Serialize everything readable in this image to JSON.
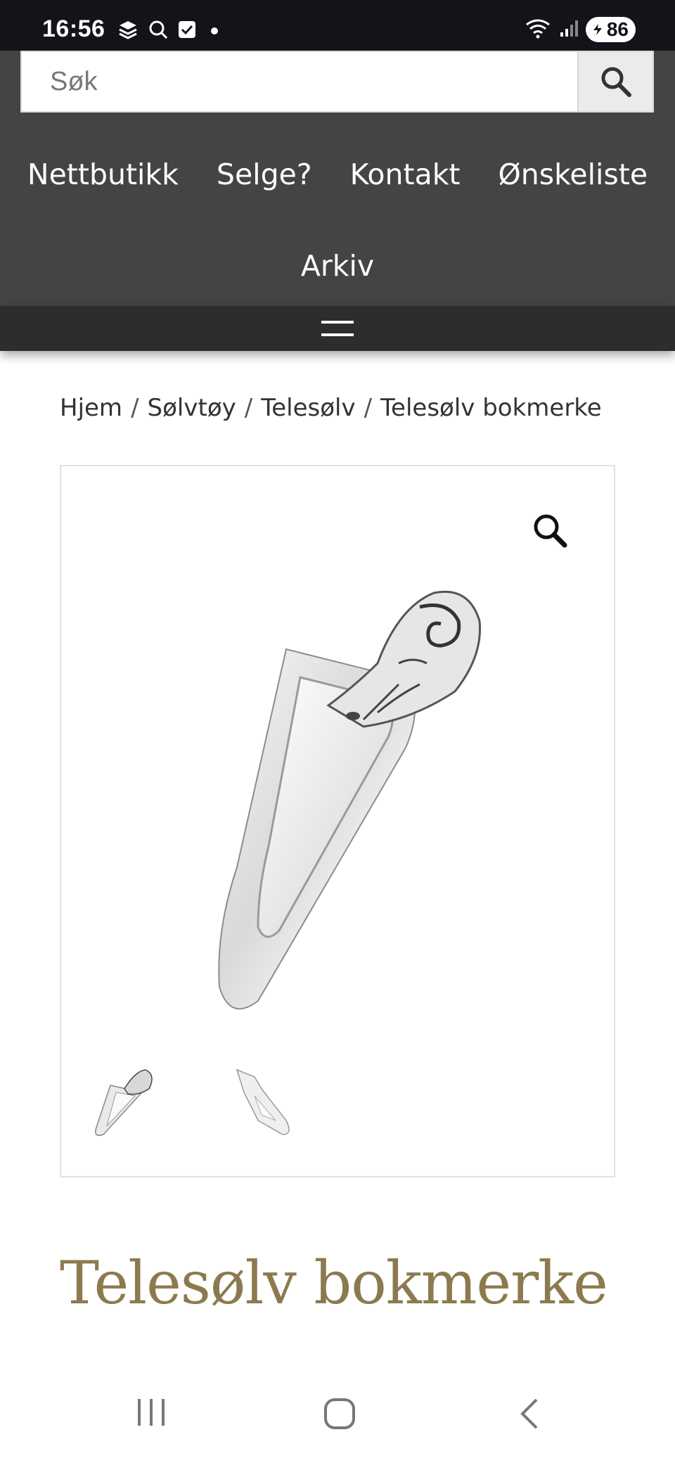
{
  "status_bar": {
    "time": "16:56",
    "battery": "86",
    "icons": [
      "stack-app-icon",
      "search-icon",
      "checkbox-icon",
      "notification-dot",
      "wifi-icon",
      "signal-icon",
      "battery-icon"
    ]
  },
  "search": {
    "placeholder": "Søk",
    "button_icon": "search-icon"
  },
  "nav": {
    "items": [
      "Nettbutikk",
      "Selge?",
      "Kontakt",
      "Ønskeliste",
      "Arkiv"
    ]
  },
  "menu_toggle": {
    "icon": "hamburger-icon"
  },
  "breadcrumb": {
    "items": [
      "Hjem",
      "Sølvtøy",
      "Telesølv",
      "Telesølv bokmerke"
    ],
    "separator": "/"
  },
  "product": {
    "title": "Telesølv bokmerke",
    "title_color": "#8c7a4f",
    "gallery": {
      "zoom_icon": "magnifier-icon",
      "thumbnails": 2
    }
  },
  "system_nav": {
    "buttons": [
      "recents-icon",
      "home-icon",
      "back-icon"
    ]
  }
}
